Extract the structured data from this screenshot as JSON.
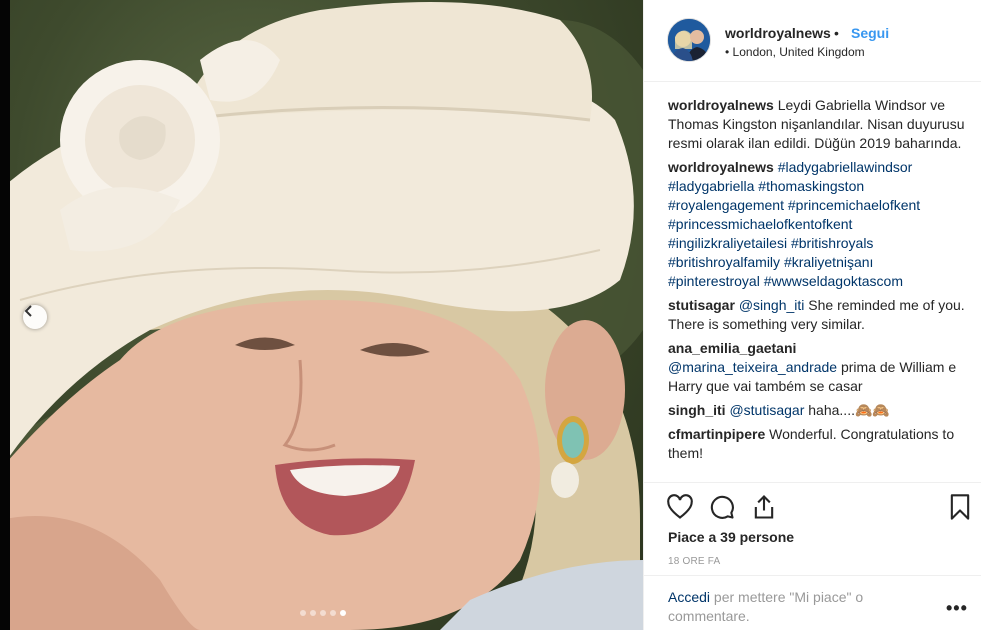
{
  "post": {
    "username": "worldroyalnews",
    "separator": "•",
    "follow_label": "Segui",
    "location": "London, United Kingdom",
    "location_bullet": "•"
  },
  "comments": [
    {
      "user": "worldroyalnews",
      "text": "Leydi Gabriella Windsor ve Thomas Kingston nişanlandılar. Nisan duyurusu resmi olarak ilan edildi. Düğün 2019 baharında."
    },
    {
      "user": "worldroyalnews",
      "hashtags": [
        "#ladygabriellawindsor",
        "#ladygabriella",
        "#thomaskingston",
        "#royalengagement",
        "#princemichaelofkent",
        "#princessmichaelofkentofkent",
        "#ingilizkraliyetailesi",
        "#britishroyals",
        "#britishroyalfamily",
        "#kraliyetnişanı",
        "#pinterestroyal",
        "#wwwseldagoktascom"
      ]
    },
    {
      "user": "stutisagar",
      "mention": "@singh_iti",
      "text": "She reminded me of you. There is something very similar."
    },
    {
      "user": "ana_emilia_gaetani",
      "mention": "@marina_teixeira_andrade",
      "text": "prima de William e Harry que vai também se casar"
    },
    {
      "user": "singh_iti",
      "mention": "@stutisagar",
      "text": "haha....🙈🙈"
    },
    {
      "user": "cfmartinpipere",
      "text": "Wonderful. Congratulations to them!"
    }
  ],
  "actions": {
    "icons": [
      "heart-icon",
      "comment-icon",
      "share-icon",
      "bookmark-icon"
    ],
    "likes": "Piace a 39 persone",
    "time": "18 ORE FA"
  },
  "login": {
    "link": "Accedi",
    "text": " per mettere \"Mi piace\" o commentare.",
    "more": "•••"
  },
  "carousel": {
    "dot_count": 5,
    "active_index": 4
  },
  "colors": {
    "link_blue": "#3897f0",
    "hashtag": "#003569",
    "muted": "#999999"
  }
}
